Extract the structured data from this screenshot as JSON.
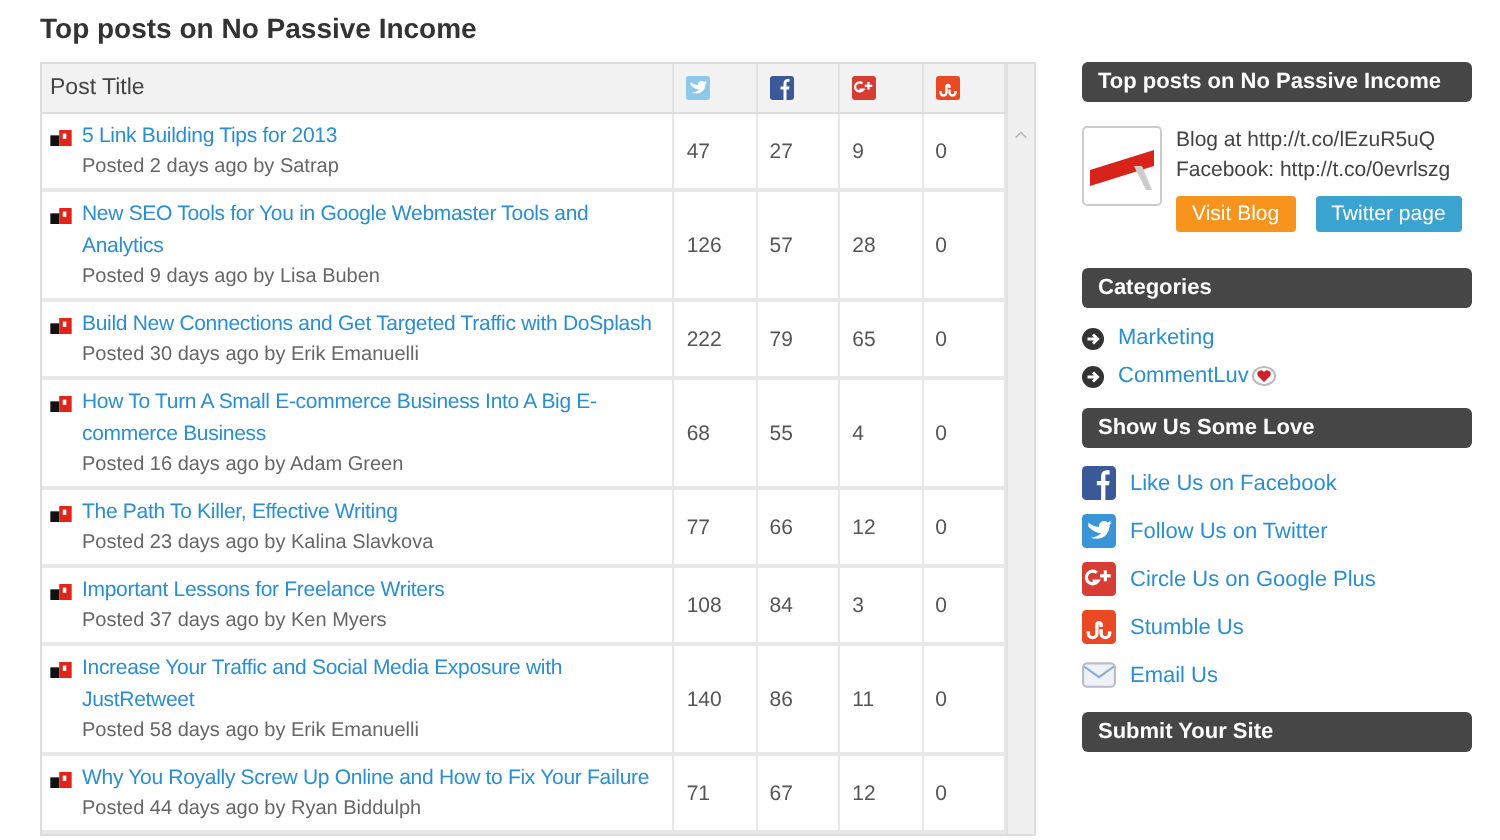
{
  "page_title": "Top posts on No Passive Income",
  "table": {
    "columns": [
      {
        "kind": "text",
        "label": "Post Title"
      },
      {
        "kind": "twitter"
      },
      {
        "kind": "facebook"
      },
      {
        "kind": "googleplus"
      },
      {
        "kind": "stumbleupon"
      }
    ],
    "rows": [
      {
        "title": "5 Link Building Tips for 2013",
        "meta": "Posted 2 days ago by Satrap",
        "counts": [
          "47",
          "27",
          "9",
          "0"
        ]
      },
      {
        "title": "New SEO Tools for You in Google Webmaster Tools and Analytics",
        "meta": "Posted 9 days ago by Lisa Buben",
        "counts": [
          "126",
          "57",
          "28",
          "0"
        ]
      },
      {
        "title": "Build New Connections and Get Targeted Traffic with DoSplash",
        "meta": "Posted 30 days ago by Erik Emanuelli",
        "counts": [
          "222",
          "79",
          "65",
          "0"
        ]
      },
      {
        "title": "How To Turn A Small E-commerce Business Into A Big E-commerce Business",
        "meta": "Posted 16 days ago by Adam Green",
        "counts": [
          "68",
          "55",
          "4",
          "0"
        ]
      },
      {
        "title": "The Path To Killer, Effective Writing",
        "meta": "Posted 23 days ago by Kalina Slavkova",
        "counts": [
          "77",
          "66",
          "12",
          "0"
        ]
      },
      {
        "title": "Important Lessons for Freelance Writers",
        "meta": "Posted 37 days ago by Ken Myers",
        "counts": [
          "108",
          "84",
          "3",
          "0"
        ]
      },
      {
        "title": "Increase Your Traffic and Social Media Exposure with JustRetweet",
        "meta": "Posted 58 days ago by Erik Emanuelli",
        "counts": [
          "140",
          "86",
          "11",
          "0"
        ]
      },
      {
        "title": "Why You Royally Screw Up Online and How to Fix Your Failure",
        "meta": "Posted 44 days ago by Ryan Biddulph",
        "counts": [
          "71",
          "67",
          "12",
          "0"
        ]
      }
    ]
  },
  "sidebar": {
    "profile": {
      "heading": "Top posts on No Passive Income",
      "lines": [
        "Blog at http://t.co/lEzuR5uQ",
        "Facebook: http://t.co/0evrlszg"
      ],
      "buttons": [
        {
          "label": "Visit Blog",
          "color": "#f7941d"
        },
        {
          "label": "Twitter page",
          "color": "#3aa3cf"
        }
      ]
    },
    "categories": {
      "heading": "Categories",
      "items": [
        {
          "label": "Marketing",
          "heart": false
        },
        {
          "label": "CommentLuv",
          "heart": true
        }
      ]
    },
    "social": {
      "heading": "Show Us Some Love",
      "items": [
        {
          "kind": "facebook",
          "label": "Like Us on Facebook"
        },
        {
          "kind": "twitter",
          "label": "Follow Us on Twitter"
        },
        {
          "kind": "googleplus",
          "label": "Circle Us on Google Plus"
        },
        {
          "kind": "stumbleupon",
          "label": "Stumble Us"
        },
        {
          "kind": "email",
          "label": "Email Us"
        }
      ]
    },
    "submit": {
      "heading": "Submit Your Site"
    }
  }
}
